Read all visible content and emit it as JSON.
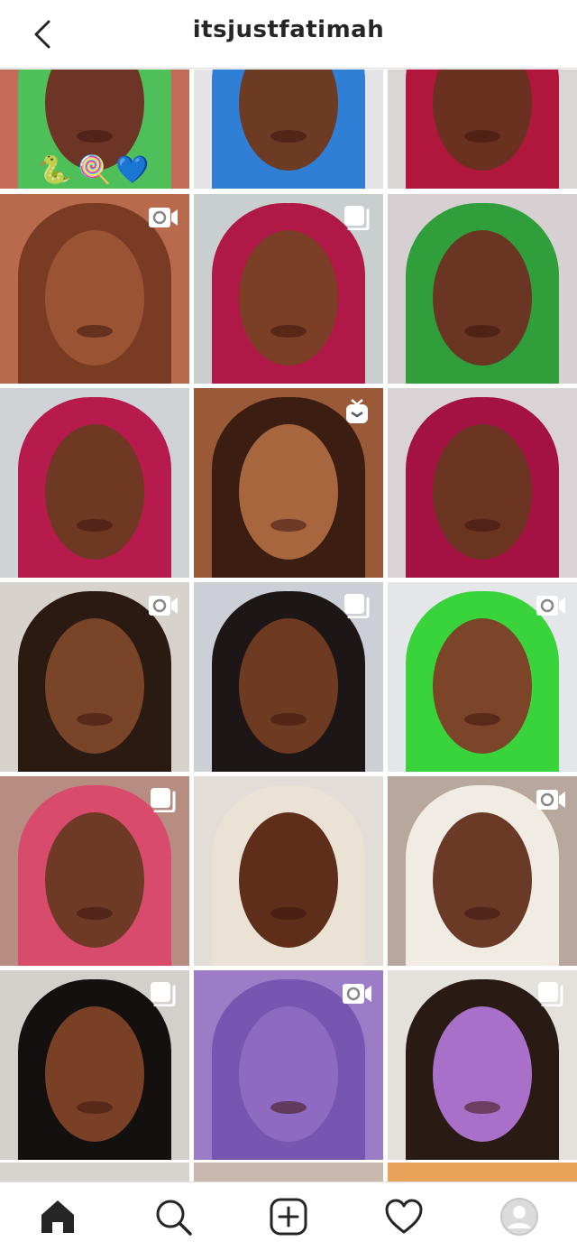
{
  "header": {
    "title": "itsjustfatimah"
  },
  "top_row_emojis": [
    "🐍",
    "🍭",
    "💙"
  ],
  "tabs": [
    "home",
    "search",
    "new-post",
    "activity",
    "profile"
  ],
  "colors": {
    "border": "#dbdbdb",
    "icon": "#262626",
    "text": "#262626"
  },
  "tiles": [
    {
      "badge": "none",
      "bg": "#c36b57",
      "hair": "#4fbf5a",
      "skin": "#6e3526"
    },
    {
      "badge": "none",
      "bg": "#e4e4e8",
      "hair": "#2f7fd6",
      "skin": "#6d3a24"
    },
    {
      "badge": "none",
      "bg": "#d9d6d4",
      "hair": "#b1163c",
      "skin": "#6b3120"
    },
    {
      "badge": "reel",
      "bg": "#b96a4d",
      "hair": "#7a3b24",
      "skin": "#9a5434"
    },
    {
      "badge": "carousel",
      "bg": "#c9cfcf",
      "hair": "#b01848",
      "skin": "#7a3f24"
    },
    {
      "badge": "none",
      "bg": "#d6d0d2",
      "hair": "#2f9e3b",
      "skin": "#6a3522"
    },
    {
      "badge": "none",
      "bg": "#cfd3d6",
      "hair": "#b71a4d",
      "skin": "#6f3823"
    },
    {
      "badge": "igtv",
      "bg": "#9a5a38",
      "hair": "#3b1d12",
      "skin": "#a8663f"
    },
    {
      "badge": "none",
      "bg": "#d9d3d6",
      "hair": "#a41244",
      "skin": "#6a3421"
    },
    {
      "badge": "reel",
      "bg": "#d8d2cc",
      "hair": "#2a1a12",
      "skin": "#7a4428"
    },
    {
      "badge": "carousel",
      "bg": "#ccd0d6",
      "hair": "#1d1616",
      "skin": "#6e3b22"
    },
    {
      "badge": "reel",
      "bg": "#e5e6ea",
      "hair": "#39d43c",
      "skin": "#7c4429"
    },
    {
      "badge": "carousel",
      "bg": "#b68d80",
      "hair": "#d94b6d",
      "skin": "#6e3a25"
    },
    {
      "badge": "none",
      "bg": "#e3ddd8",
      "hair": "#eae2d4",
      "skin": "#5e2e1b"
    },
    {
      "badge": "reel",
      "bg": "#b7a79c",
      "hair": "#f0ece3",
      "skin": "#6b3a26"
    },
    {
      "badge": "carousel",
      "bg": "#d3d0cc",
      "hair": "#141010",
      "skin": "#7a4026"
    },
    {
      "badge": "reel",
      "bg": "#9c7bc7",
      "hair": "#7756b2",
      "skin": "#8f6ac2"
    },
    {
      "badge": "carousel",
      "bg": "#e4e0dc",
      "hair": "#2a1a14",
      "skin": "#a870c8"
    }
  ]
}
